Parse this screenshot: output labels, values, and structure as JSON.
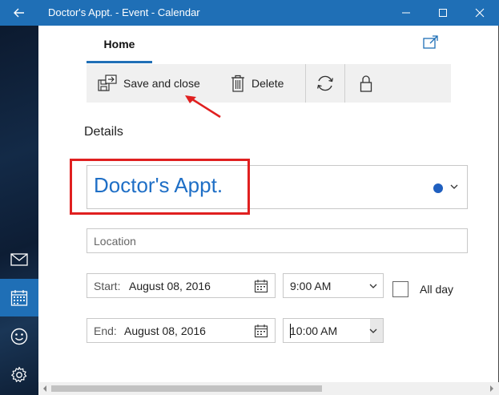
{
  "window": {
    "title": "Doctor's Appt. - Event - Calendar",
    "accent_color": "#1f6fb6"
  },
  "nav_rail": {
    "items": [
      {
        "name": "mail",
        "icon": "mail-icon"
      },
      {
        "name": "calendar",
        "icon": "calendar-icon",
        "selected": true
      },
      {
        "name": "feedback",
        "icon": "smiley-icon"
      },
      {
        "name": "settings",
        "icon": "gear-icon"
      }
    ]
  },
  "tabs": {
    "home_label": "Home"
  },
  "toolbar": {
    "save_label": "Save and close",
    "delete_label": "Delete"
  },
  "details": {
    "heading": "Details",
    "event_title": "Doctor's Appt.",
    "event_color": "#1f5fbf",
    "location_placeholder": "Location",
    "start": {
      "label": "Start:",
      "date": "August 08, 2016",
      "time": "9:00 AM"
    },
    "end": {
      "label": "End:",
      "date": "August 08, 2016",
      "time": "10:00 AM"
    },
    "all_day_label": "All day",
    "all_day_checked": false
  },
  "annotation": {
    "highlight_color": "#e02020"
  }
}
